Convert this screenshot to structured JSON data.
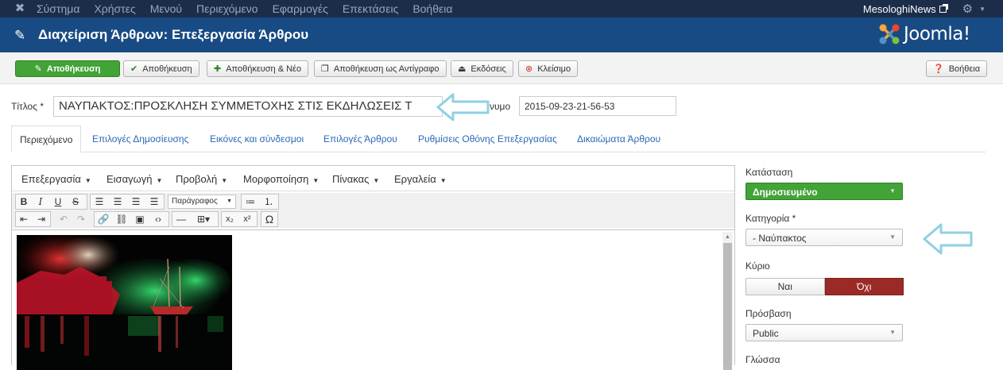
{
  "navbar": {
    "menu": [
      "Σύστημα",
      "Χρήστες",
      "Μενού",
      "Περιεχόμενο",
      "Εφαρμογές",
      "Επεκτάσεις",
      "Βοήθεια"
    ],
    "site_name": "MesologhiNews"
  },
  "header": {
    "title": "Διαχείριση Άρθρων: Επεξεργασία Άρθρου",
    "brand": "Joomla!"
  },
  "toolbar": {
    "save": "Αποθήκευση",
    "save_close": "Αποθήκευση",
    "save_new": "Αποθήκευση & Νέο",
    "save_copy": "Αποθήκευση ως Αντίγραφο",
    "versions": "Εκδόσεις",
    "close": "Κλείσιμο",
    "help": "Βοήθεια"
  },
  "form": {
    "title_label": "Τίτλος *",
    "title_value": "ΝΑΥΠΑΚΤΟΣ:ΠΡΟΣΚΛΗΣΗ ΣΥΜΜΕΤΟΧΗΣ ΣΤΙΣ ΕΚΔΗΛΩΣΕΙΣ Τ",
    "alias_label": "Ψευδώνυμο",
    "alias_value": "2015-09-23-21-56-53"
  },
  "tabs": [
    "Περιεχόμενο",
    "Επιλογές Δημοσίευσης",
    "Εικόνες και σύνδεσμοι",
    "Επιλογές Άρθρου",
    "Ρυθμίσεις Οθόνης Επεξεργασίας",
    "Δικαιώματα Άρθρου"
  ],
  "editor": {
    "menus": [
      "Επεξεργασία",
      "Εισαγωγή",
      "Προβολή",
      "Μορφοποίηση",
      "Πίνακας",
      "Εργαλεία"
    ],
    "format_select": "Παράγραφος"
  },
  "sidebar": {
    "status_label": "Κατάσταση",
    "status_value": "Δημοσιευμένο",
    "category_label": "Κατηγορία *",
    "category_value": "- Ναύπακτος",
    "featured_label": "Κύριο",
    "featured_yes": "Ναι",
    "featured_no": "Όχι",
    "access_label": "Πρόσβαση",
    "access_value": "Public",
    "language_label": "Γλώσσα"
  },
  "colors": {
    "navbar": "#1c2d4a",
    "header": "#184b83",
    "success": "#42a337",
    "danger": "#9b2a26",
    "link": "#2a69b8",
    "annotation_arrow": "#8fd0e2"
  }
}
